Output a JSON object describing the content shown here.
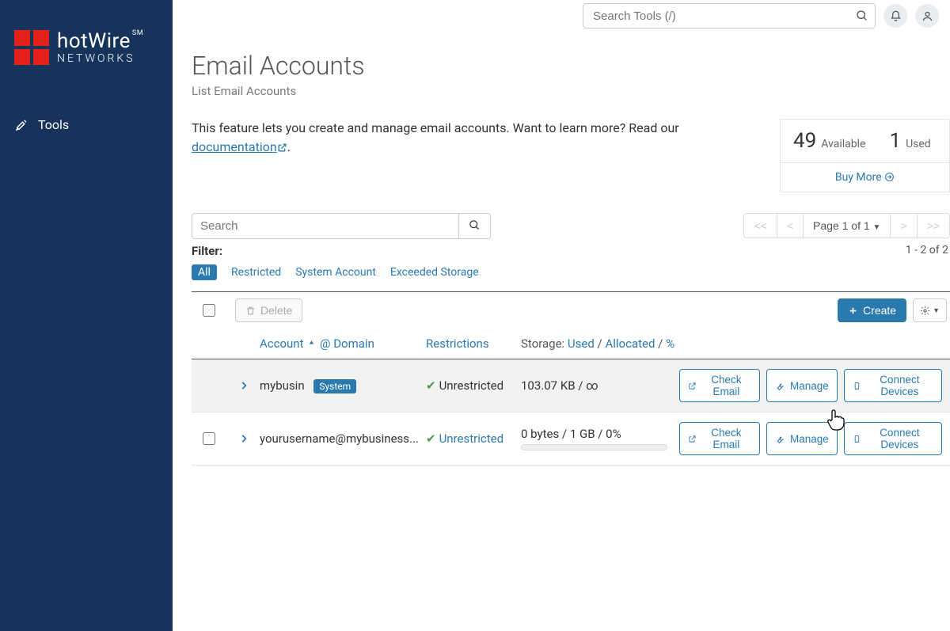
{
  "brand": {
    "name": "hotWire",
    "suffix": "SM",
    "sub": "NETWORKS"
  },
  "sidebar": {
    "items": [
      {
        "label": "Tools"
      }
    ]
  },
  "topbar": {
    "search_placeholder": "Search Tools (/)"
  },
  "page": {
    "title": "Email Accounts",
    "subtitle": "List Email Accounts",
    "description_pre": "This feature lets you create and manage email accounts. Want to learn more? Read our ",
    "description_link": "documentation",
    "description_post": "."
  },
  "stats": {
    "available_num": "49",
    "available_label": "Available",
    "used_num": "1",
    "used_label": "Used",
    "buy_more": "Buy More"
  },
  "search": {
    "placeholder": "Search"
  },
  "pager": {
    "first": "<<",
    "prev": "<",
    "label": "Page 1 of 1",
    "next": ">",
    "last": ">>",
    "count": "1 - 2 of 2"
  },
  "filter": {
    "heading": "Filter:",
    "all": "All",
    "restricted": "Restricted",
    "system": "System Account",
    "exceeded": "Exceeded Storage"
  },
  "actions": {
    "delete": "Delete",
    "create": "Create"
  },
  "columns": {
    "account": "Account",
    "at": "@",
    "domain": "Domain",
    "restrictions": "Restrictions",
    "storage_label": "Storage:",
    "used": "Used",
    "allocated": "Allocated",
    "percent": "%"
  },
  "row_buttons": {
    "check_email": "Check Email",
    "manage": "Manage",
    "connect": "Connect Devices"
  },
  "rows": [
    {
      "account": "mybusin",
      "system_badge": "System",
      "restriction": "Unrestricted",
      "restriction_link": false,
      "storage_text": "103.07 KB / ∞",
      "has_progress": false
    },
    {
      "account": "yourusername@mybusiness...",
      "system_badge": null,
      "restriction": "Unrestricted",
      "restriction_link": true,
      "storage_text": "0 bytes / 1 GB / 0%",
      "has_progress": true
    }
  ]
}
